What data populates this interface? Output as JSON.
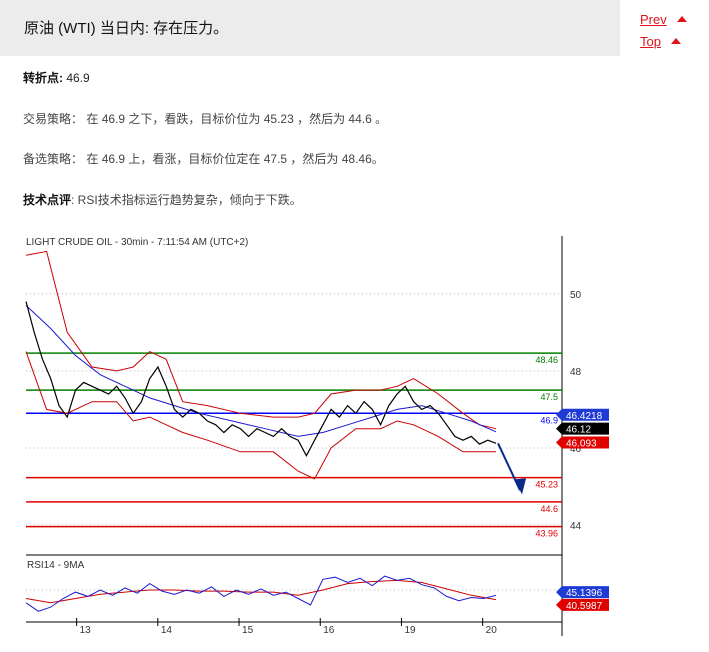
{
  "header": {
    "title": "原油 (WTI) 当日内: 存在压力。",
    "prev_label": "Prev",
    "top_label": "Top"
  },
  "analysis": {
    "pivot_label": "转折点:",
    "pivot_value": "46.9",
    "strategy_label": "交易策略：",
    "strategy_text": "在 46.9 之下，看跌，目标价位为 45.23 ，然后为 44.6 。",
    "alternative_label": "备选策略：",
    "alternative_text": "在 46.9 上，看涨，目标价位定在 47.5 ，然后为 48.46。",
    "comment_label": "技术点评",
    "comment_text": ": RSI技术指标运行趋势复杂，倾向于下跌。"
  },
  "colors": {
    "accent": "#e2121b",
    "resistance": "#008000",
    "pivot": "#0000ff",
    "support": "#e00000",
    "price": "#000000",
    "bollinger": "#cc0000",
    "moving_average": "#1a1ad0",
    "rsi_line": "#1a1ad0",
    "rsi_ma": "#cc0000",
    "forecast_arrow": "#0a2a8a",
    "tag_blue": "#1f3bd6",
    "tag_black": "#000000",
    "tag_red": "#e00000"
  },
  "chart_data": {
    "type": "line",
    "title": "LIGHT CRUDE OIL - 30min - 7:11:54 AM (UTC+2)",
    "y_ticks": [
      44,
      46,
      48,
      50
    ],
    "ylim": [
      43.3,
      51.5
    ],
    "x_ticks": [
      "13",
      "14",
      "15",
      "16",
      "19",
      "20"
    ],
    "levels": [
      {
        "label": "48.46",
        "value": 48.46,
        "kind": "resistance"
      },
      {
        "label": "47.5",
        "value": 47.5,
        "kind": "resistance"
      },
      {
        "label": "46.9",
        "value": 46.9,
        "kind": "pivot"
      },
      {
        "label": "45.23",
        "value": 45.23,
        "kind": "support"
      },
      {
        "label": "44.6",
        "value": 44.6,
        "kind": "support"
      },
      {
        "label": "43.96",
        "value": 43.96,
        "kind": "support"
      }
    ],
    "price_tags": [
      {
        "label": "46.4218",
        "value": 46.4218,
        "kind": "blue"
      },
      {
        "label": "46.12",
        "value": 46.12,
        "kind": "black"
      },
      {
        "label": "46.093",
        "value": 46.093,
        "kind": "red"
      }
    ],
    "forecast": {
      "from": 46.12,
      "to": 44.9
    },
    "price_series": [
      {
        "x": 0,
        "y": 49.8
      },
      {
        "x": 2,
        "y": 49.0
      },
      {
        "x": 4,
        "y": 48.3
      },
      {
        "x": 6,
        "y": 47.8
      },
      {
        "x": 8,
        "y": 47.1
      },
      {
        "x": 10,
        "y": 46.8
      },
      {
        "x": 12,
        "y": 47.5
      },
      {
        "x": 14,
        "y": 47.7
      },
      {
        "x": 16,
        "y": 47.6
      },
      {
        "x": 18,
        "y": 47.5
      },
      {
        "x": 20,
        "y": 47.4
      },
      {
        "x": 22,
        "y": 47.6
      },
      {
        "x": 24,
        "y": 47.3
      },
      {
        "x": 26,
        "y": 46.9
      },
      {
        "x": 28,
        "y": 47.2
      },
      {
        "x": 30,
        "y": 47.8
      },
      {
        "x": 32,
        "y": 48.1
      },
      {
        "x": 34,
        "y": 47.6
      },
      {
        "x": 36,
        "y": 47.0
      },
      {
        "x": 38,
        "y": 46.8
      },
      {
        "x": 40,
        "y": 47.0
      },
      {
        "x": 42,
        "y": 46.9
      },
      {
        "x": 44,
        "y": 46.7
      },
      {
        "x": 46,
        "y": 46.6
      },
      {
        "x": 48,
        "y": 46.4
      },
      {
        "x": 50,
        "y": 46.6
      },
      {
        "x": 52,
        "y": 46.5
      },
      {
        "x": 54,
        "y": 46.3
      },
      {
        "x": 56,
        "y": 46.5
      },
      {
        "x": 58,
        "y": 46.4
      },
      {
        "x": 60,
        "y": 46.3
      },
      {
        "x": 62,
        "y": 46.5
      },
      {
        "x": 64,
        "y": 46.3
      },
      {
        "x": 66,
        "y": 46.2
      },
      {
        "x": 68,
        "y": 45.8
      },
      {
        "x": 70,
        "y": 46.2
      },
      {
        "x": 72,
        "y": 46.6
      },
      {
        "x": 74,
        "y": 47.0
      },
      {
        "x": 76,
        "y": 46.8
      },
      {
        "x": 78,
        "y": 47.1
      },
      {
        "x": 80,
        "y": 46.9
      },
      {
        "x": 82,
        "y": 47.2
      },
      {
        "x": 84,
        "y": 47.0
      },
      {
        "x": 86,
        "y": 46.6
      },
      {
        "x": 88,
        "y": 47.1
      },
      {
        "x": 90,
        "y": 47.4
      },
      {
        "x": 92,
        "y": 47.6
      },
      {
        "x": 94,
        "y": 47.2
      },
      {
        "x": 96,
        "y": 47.0
      },
      {
        "x": 98,
        "y": 47.1
      },
      {
        "x": 100,
        "y": 46.9
      },
      {
        "x": 102,
        "y": 46.6
      },
      {
        "x": 104,
        "y": 46.3
      },
      {
        "x": 106,
        "y": 46.2
      },
      {
        "x": 108,
        "y": 46.3
      },
      {
        "x": 110,
        "y": 46.1
      },
      {
        "x": 112,
        "y": 46.2
      },
      {
        "x": 114,
        "y": 46.12
      }
    ],
    "bb_upper": [
      {
        "x": 0,
        "y": 51.0
      },
      {
        "x": 5,
        "y": 51.1
      },
      {
        "x": 10,
        "y": 49.0
      },
      {
        "x": 16,
        "y": 48.1
      },
      {
        "x": 22,
        "y": 48.0
      },
      {
        "x": 26,
        "y": 48.1
      },
      {
        "x": 30,
        "y": 48.5
      },
      {
        "x": 34,
        "y": 48.3
      },
      {
        "x": 38,
        "y": 47.2
      },
      {
        "x": 44,
        "y": 47.1
      },
      {
        "x": 52,
        "y": 46.9
      },
      {
        "x": 60,
        "y": 46.8
      },
      {
        "x": 66,
        "y": 46.8
      },
      {
        "x": 70,
        "y": 46.9
      },
      {
        "x": 74,
        "y": 47.4
      },
      {
        "x": 80,
        "y": 47.5
      },
      {
        "x": 86,
        "y": 47.5
      },
      {
        "x": 90,
        "y": 47.6
      },
      {
        "x": 94,
        "y": 47.8
      },
      {
        "x": 100,
        "y": 47.4
      },
      {
        "x": 106,
        "y": 46.9
      },
      {
        "x": 110,
        "y": 46.6
      },
      {
        "x": 114,
        "y": 46.5
      }
    ],
    "bb_lower": [
      {
        "x": 0,
        "y": 48.5
      },
      {
        "x": 5,
        "y": 47.0
      },
      {
        "x": 10,
        "y": 46.9
      },
      {
        "x": 16,
        "y": 47.2
      },
      {
        "x": 22,
        "y": 47.2
      },
      {
        "x": 26,
        "y": 46.7
      },
      {
        "x": 30,
        "y": 46.8
      },
      {
        "x": 34,
        "y": 46.6
      },
      {
        "x": 38,
        "y": 46.4
      },
      {
        "x": 44,
        "y": 46.2
      },
      {
        "x": 52,
        "y": 45.9
      },
      {
        "x": 60,
        "y": 45.9
      },
      {
        "x": 66,
        "y": 45.4
      },
      {
        "x": 70,
        "y": 45.2
      },
      {
        "x": 74,
        "y": 46.0
      },
      {
        "x": 80,
        "y": 46.5
      },
      {
        "x": 86,
        "y": 46.5
      },
      {
        "x": 90,
        "y": 46.7
      },
      {
        "x": 94,
        "y": 46.6
      },
      {
        "x": 100,
        "y": 46.3
      },
      {
        "x": 106,
        "y": 45.9
      },
      {
        "x": 110,
        "y": 45.9
      },
      {
        "x": 114,
        "y": 45.9
      }
    ],
    "moving_average": [
      {
        "x": 0,
        "y": 49.7
      },
      {
        "x": 6,
        "y": 49.1
      },
      {
        "x": 12,
        "y": 48.4
      },
      {
        "x": 18,
        "y": 47.9
      },
      {
        "x": 24,
        "y": 47.6
      },
      {
        "x": 30,
        "y": 47.3
      },
      {
        "x": 36,
        "y": 47.1
      },
      {
        "x": 42,
        "y": 46.9
      },
      {
        "x": 50,
        "y": 46.7
      },
      {
        "x": 58,
        "y": 46.5
      },
      {
        "x": 66,
        "y": 46.3
      },
      {
        "x": 72,
        "y": 46.4
      },
      {
        "x": 78,
        "y": 46.6
      },
      {
        "x": 84,
        "y": 46.8
      },
      {
        "x": 90,
        "y": 47.0
      },
      {
        "x": 96,
        "y": 47.1
      },
      {
        "x": 102,
        "y": 46.9
      },
      {
        "x": 108,
        "y": 46.7
      },
      {
        "x": 114,
        "y": 46.42
      }
    ],
    "x_max": 130,
    "rsi": {
      "label": "RSI14 - 9MA",
      "y_ticks": [
        50
      ],
      "ylim": [
        20,
        80
      ],
      "tags": [
        {
          "label": "45.1396",
          "value": 45.1396,
          "kind": "blue"
        },
        {
          "label": "40.5987",
          "value": 40.5987,
          "kind": "red"
        }
      ],
      "rsi_series": [
        {
          "x": 0,
          "y": 38
        },
        {
          "x": 3,
          "y": 30
        },
        {
          "x": 6,
          "y": 34
        },
        {
          "x": 9,
          "y": 42
        },
        {
          "x": 12,
          "y": 48
        },
        {
          "x": 15,
          "y": 44
        },
        {
          "x": 18,
          "y": 50
        },
        {
          "x": 21,
          "y": 45
        },
        {
          "x": 24,
          "y": 52
        },
        {
          "x": 27,
          "y": 47
        },
        {
          "x": 30,
          "y": 56
        },
        {
          "x": 33,
          "y": 49
        },
        {
          "x": 36,
          "y": 46
        },
        {
          "x": 39,
          "y": 50
        },
        {
          "x": 42,
          "y": 47
        },
        {
          "x": 45,
          "y": 53
        },
        {
          "x": 48,
          "y": 44
        },
        {
          "x": 51,
          "y": 50
        },
        {
          "x": 54,
          "y": 46
        },
        {
          "x": 57,
          "y": 51
        },
        {
          "x": 60,
          "y": 45
        },
        {
          "x": 63,
          "y": 48
        },
        {
          "x": 66,
          "y": 42
        },
        {
          "x": 69,
          "y": 36
        },
        {
          "x": 72,
          "y": 60
        },
        {
          "x": 75,
          "y": 62
        },
        {
          "x": 78,
          "y": 57
        },
        {
          "x": 81,
          "y": 61
        },
        {
          "x": 84,
          "y": 54
        },
        {
          "x": 87,
          "y": 63
        },
        {
          "x": 90,
          "y": 59
        },
        {
          "x": 93,
          "y": 61
        },
        {
          "x": 96,
          "y": 55
        },
        {
          "x": 99,
          "y": 52
        },
        {
          "x": 102,
          "y": 44
        },
        {
          "x": 105,
          "y": 40
        },
        {
          "x": 108,
          "y": 43
        },
        {
          "x": 111,
          "y": 42
        },
        {
          "x": 114,
          "y": 45
        }
      ],
      "rsi_ma": [
        {
          "x": 0,
          "y": 42
        },
        {
          "x": 6,
          "y": 38
        },
        {
          "x": 12,
          "y": 42
        },
        {
          "x": 18,
          "y": 46
        },
        {
          "x": 24,
          "y": 48
        },
        {
          "x": 30,
          "y": 50
        },
        {
          "x": 36,
          "y": 50
        },
        {
          "x": 42,
          "y": 49
        },
        {
          "x": 48,
          "y": 49
        },
        {
          "x": 54,
          "y": 48
        },
        {
          "x": 60,
          "y": 48
        },
        {
          "x": 66,
          "y": 45
        },
        {
          "x": 72,
          "y": 50
        },
        {
          "x": 78,
          "y": 56
        },
        {
          "x": 84,
          "y": 58
        },
        {
          "x": 90,
          "y": 59
        },
        {
          "x": 96,
          "y": 57
        },
        {
          "x": 102,
          "y": 51
        },
        {
          "x": 108,
          "y": 45
        },
        {
          "x": 114,
          "y": 41
        }
      ]
    }
  }
}
